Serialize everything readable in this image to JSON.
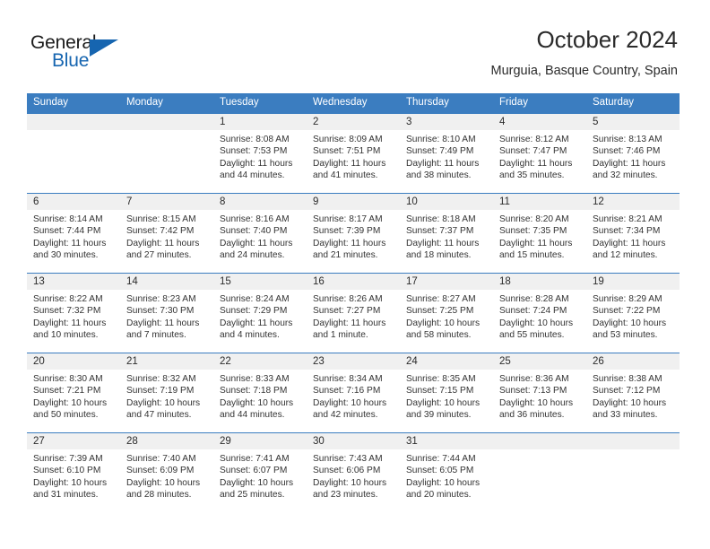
{
  "brand": {
    "name_part1": "General",
    "name_part2": "Blue",
    "flag_icon": "flag-triangle-icon",
    "accent_color": "#1665b0"
  },
  "header": {
    "title": "October 2024",
    "subtitle": "Murguia, Basque Country, Spain"
  },
  "theme": {
    "header_row_color": "#3b7dc0",
    "daynum_band_color": "#f0f0f0",
    "text_color": "#2b2b2b"
  },
  "weekday_headers": [
    "Sunday",
    "Monday",
    "Tuesday",
    "Wednesday",
    "Thursday",
    "Friday",
    "Saturday"
  ],
  "weeks": [
    [
      {
        "day": "",
        "empty": true,
        "sunrise": "",
        "sunset": "",
        "daylight1": "",
        "daylight2": ""
      },
      {
        "day": "",
        "empty": true,
        "sunrise": "",
        "sunset": "",
        "daylight1": "",
        "daylight2": ""
      },
      {
        "day": "1",
        "empty": false,
        "sunrise": "Sunrise: 8:08 AM",
        "sunset": "Sunset: 7:53 PM",
        "daylight1": "Daylight: 11 hours",
        "daylight2": "and 44 minutes."
      },
      {
        "day": "2",
        "empty": false,
        "sunrise": "Sunrise: 8:09 AM",
        "sunset": "Sunset: 7:51 PM",
        "daylight1": "Daylight: 11 hours",
        "daylight2": "and 41 minutes."
      },
      {
        "day": "3",
        "empty": false,
        "sunrise": "Sunrise: 8:10 AM",
        "sunset": "Sunset: 7:49 PM",
        "daylight1": "Daylight: 11 hours",
        "daylight2": "and 38 minutes."
      },
      {
        "day": "4",
        "empty": false,
        "sunrise": "Sunrise: 8:12 AM",
        "sunset": "Sunset: 7:47 PM",
        "daylight1": "Daylight: 11 hours",
        "daylight2": "and 35 minutes."
      },
      {
        "day": "5",
        "empty": false,
        "sunrise": "Sunrise: 8:13 AM",
        "sunset": "Sunset: 7:46 PM",
        "daylight1": "Daylight: 11 hours",
        "daylight2": "and 32 minutes."
      }
    ],
    [
      {
        "day": "6",
        "empty": false,
        "sunrise": "Sunrise: 8:14 AM",
        "sunset": "Sunset: 7:44 PM",
        "daylight1": "Daylight: 11 hours",
        "daylight2": "and 30 minutes."
      },
      {
        "day": "7",
        "empty": false,
        "sunrise": "Sunrise: 8:15 AM",
        "sunset": "Sunset: 7:42 PM",
        "daylight1": "Daylight: 11 hours",
        "daylight2": "and 27 minutes."
      },
      {
        "day": "8",
        "empty": false,
        "sunrise": "Sunrise: 8:16 AM",
        "sunset": "Sunset: 7:40 PM",
        "daylight1": "Daylight: 11 hours",
        "daylight2": "and 24 minutes."
      },
      {
        "day": "9",
        "empty": false,
        "sunrise": "Sunrise: 8:17 AM",
        "sunset": "Sunset: 7:39 PM",
        "daylight1": "Daylight: 11 hours",
        "daylight2": "and 21 minutes."
      },
      {
        "day": "10",
        "empty": false,
        "sunrise": "Sunrise: 8:18 AM",
        "sunset": "Sunset: 7:37 PM",
        "daylight1": "Daylight: 11 hours",
        "daylight2": "and 18 minutes."
      },
      {
        "day": "11",
        "empty": false,
        "sunrise": "Sunrise: 8:20 AM",
        "sunset": "Sunset: 7:35 PM",
        "daylight1": "Daylight: 11 hours",
        "daylight2": "and 15 minutes."
      },
      {
        "day": "12",
        "empty": false,
        "sunrise": "Sunrise: 8:21 AM",
        "sunset": "Sunset: 7:34 PM",
        "daylight1": "Daylight: 11 hours",
        "daylight2": "and 12 minutes."
      }
    ],
    [
      {
        "day": "13",
        "empty": false,
        "sunrise": "Sunrise: 8:22 AM",
        "sunset": "Sunset: 7:32 PM",
        "daylight1": "Daylight: 11 hours",
        "daylight2": "and 10 minutes."
      },
      {
        "day": "14",
        "empty": false,
        "sunrise": "Sunrise: 8:23 AM",
        "sunset": "Sunset: 7:30 PM",
        "daylight1": "Daylight: 11 hours",
        "daylight2": "and 7 minutes."
      },
      {
        "day": "15",
        "empty": false,
        "sunrise": "Sunrise: 8:24 AM",
        "sunset": "Sunset: 7:29 PM",
        "daylight1": "Daylight: 11 hours",
        "daylight2": "and 4 minutes."
      },
      {
        "day": "16",
        "empty": false,
        "sunrise": "Sunrise: 8:26 AM",
        "sunset": "Sunset: 7:27 PM",
        "daylight1": "Daylight: 11 hours",
        "daylight2": "and 1 minute."
      },
      {
        "day": "17",
        "empty": false,
        "sunrise": "Sunrise: 8:27 AM",
        "sunset": "Sunset: 7:25 PM",
        "daylight1": "Daylight: 10 hours",
        "daylight2": "and 58 minutes."
      },
      {
        "day": "18",
        "empty": false,
        "sunrise": "Sunrise: 8:28 AM",
        "sunset": "Sunset: 7:24 PM",
        "daylight1": "Daylight: 10 hours",
        "daylight2": "and 55 minutes."
      },
      {
        "day": "19",
        "empty": false,
        "sunrise": "Sunrise: 8:29 AM",
        "sunset": "Sunset: 7:22 PM",
        "daylight1": "Daylight: 10 hours",
        "daylight2": "and 53 minutes."
      }
    ],
    [
      {
        "day": "20",
        "empty": false,
        "sunrise": "Sunrise: 8:30 AM",
        "sunset": "Sunset: 7:21 PM",
        "daylight1": "Daylight: 10 hours",
        "daylight2": "and 50 minutes."
      },
      {
        "day": "21",
        "empty": false,
        "sunrise": "Sunrise: 8:32 AM",
        "sunset": "Sunset: 7:19 PM",
        "daylight1": "Daylight: 10 hours",
        "daylight2": "and 47 minutes."
      },
      {
        "day": "22",
        "empty": false,
        "sunrise": "Sunrise: 8:33 AM",
        "sunset": "Sunset: 7:18 PM",
        "daylight1": "Daylight: 10 hours",
        "daylight2": "and 44 minutes."
      },
      {
        "day": "23",
        "empty": false,
        "sunrise": "Sunrise: 8:34 AM",
        "sunset": "Sunset: 7:16 PM",
        "daylight1": "Daylight: 10 hours",
        "daylight2": "and 42 minutes."
      },
      {
        "day": "24",
        "empty": false,
        "sunrise": "Sunrise: 8:35 AM",
        "sunset": "Sunset: 7:15 PM",
        "daylight1": "Daylight: 10 hours",
        "daylight2": "and 39 minutes."
      },
      {
        "day": "25",
        "empty": false,
        "sunrise": "Sunrise: 8:36 AM",
        "sunset": "Sunset: 7:13 PM",
        "daylight1": "Daylight: 10 hours",
        "daylight2": "and 36 minutes."
      },
      {
        "day": "26",
        "empty": false,
        "sunrise": "Sunrise: 8:38 AM",
        "sunset": "Sunset: 7:12 PM",
        "daylight1": "Daylight: 10 hours",
        "daylight2": "and 33 minutes."
      }
    ],
    [
      {
        "day": "27",
        "empty": false,
        "sunrise": "Sunrise: 7:39 AM",
        "sunset": "Sunset: 6:10 PM",
        "daylight1": "Daylight: 10 hours",
        "daylight2": "and 31 minutes."
      },
      {
        "day": "28",
        "empty": false,
        "sunrise": "Sunrise: 7:40 AM",
        "sunset": "Sunset: 6:09 PM",
        "daylight1": "Daylight: 10 hours",
        "daylight2": "and 28 minutes."
      },
      {
        "day": "29",
        "empty": false,
        "sunrise": "Sunrise: 7:41 AM",
        "sunset": "Sunset: 6:07 PM",
        "daylight1": "Daylight: 10 hours",
        "daylight2": "and 25 minutes."
      },
      {
        "day": "30",
        "empty": false,
        "sunrise": "Sunrise: 7:43 AM",
        "sunset": "Sunset: 6:06 PM",
        "daylight1": "Daylight: 10 hours",
        "daylight2": "and 23 minutes."
      },
      {
        "day": "31",
        "empty": false,
        "sunrise": "Sunrise: 7:44 AM",
        "sunset": "Sunset: 6:05 PM",
        "daylight1": "Daylight: 10 hours",
        "daylight2": "and 20 minutes."
      },
      {
        "day": "",
        "empty": true,
        "sunrise": "",
        "sunset": "",
        "daylight1": "",
        "daylight2": ""
      },
      {
        "day": "",
        "empty": true,
        "sunrise": "",
        "sunset": "",
        "daylight1": "",
        "daylight2": ""
      }
    ]
  ]
}
